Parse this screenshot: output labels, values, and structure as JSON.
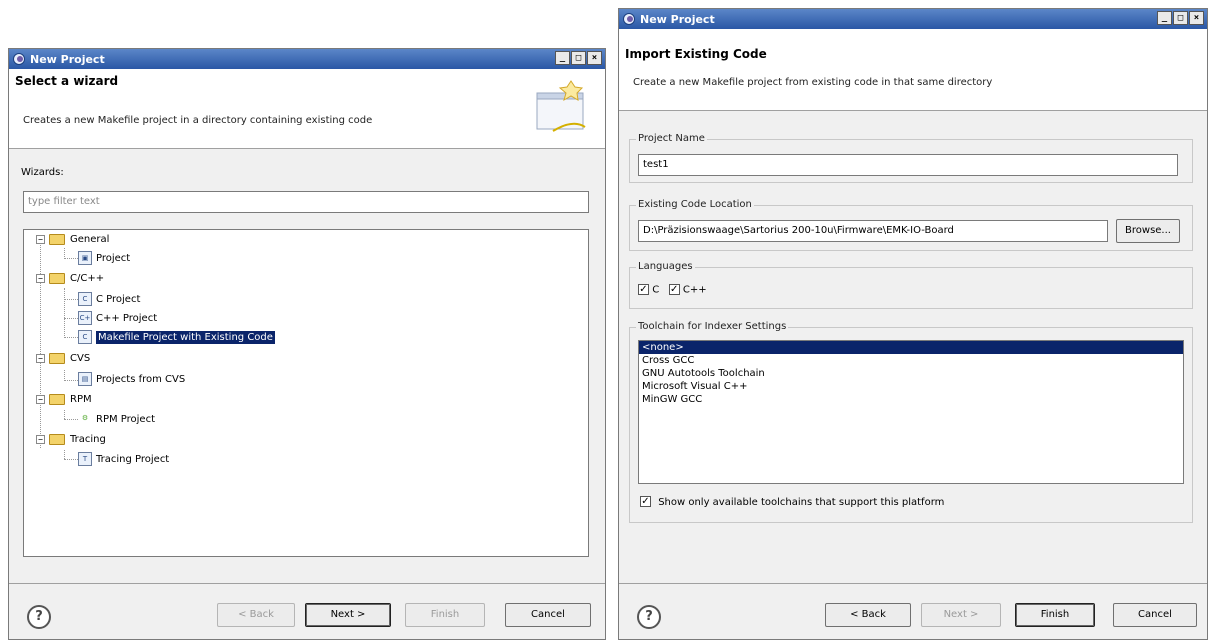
{
  "left_window": {
    "title": "New Project",
    "header_title": "Select a wizard",
    "header_desc": "Creates a new Makefile project in a directory containing existing code",
    "wizards_label": "Wizards:",
    "filter_placeholder": "type filter text",
    "tree": [
      {
        "label": "General",
        "type": "folder",
        "level": 0
      },
      {
        "label": "Project",
        "type": "item",
        "level": 1
      },
      {
        "label": "C/C++",
        "type": "folder",
        "level": 0
      },
      {
        "label": "C Project",
        "type": "item",
        "level": 1,
        "icon_text": "C"
      },
      {
        "label": "C++ Project",
        "type": "item",
        "level": 1,
        "icon_text": "C+"
      },
      {
        "label": "Makefile Project with Existing Code",
        "type": "item",
        "level": 1,
        "selected": true,
        "icon_text": "C"
      },
      {
        "label": "CVS",
        "type": "folder",
        "level": 0
      },
      {
        "label": "Projects from CVS",
        "type": "item",
        "level": 1
      },
      {
        "label": "RPM",
        "type": "folder",
        "level": 0
      },
      {
        "label": "RPM Project",
        "type": "item",
        "level": 1
      },
      {
        "label": "Tracing",
        "type": "folder",
        "level": 0
      },
      {
        "label": "Tracing Project",
        "type": "item",
        "level": 1,
        "icon_text": "T"
      }
    ],
    "buttons": {
      "back": "< Back",
      "next": "Next >",
      "finish": "Finish",
      "cancel": "Cancel"
    }
  },
  "right_window": {
    "title": "New Project",
    "header_title": "Import Existing Code",
    "header_desc": "Create a new Makefile project from existing code in that same directory",
    "project_name_label": "Project Name",
    "project_name_value": "test1",
    "location_label": "Existing Code Location",
    "location_value": "D:\\Präzisionswaage\\Sartorius 200-10u\\Firmware\\EMK-IO-Board",
    "browse_label": "Browse...",
    "languages_label": "Languages",
    "lang_c": "C",
    "lang_cpp": "C++",
    "toolchain_label": "Toolchain for Indexer Settings",
    "toolchains": [
      "<none>",
      "Cross GCC",
      "GNU Autotools Toolchain",
      "Microsoft Visual C++",
      "MinGW GCC"
    ],
    "selected_toolchain": "<none>",
    "show_only_label": "Show only available toolchains that support this platform",
    "buttons": {
      "back": "< Back",
      "next": "Next >",
      "finish": "Finish",
      "cancel": "Cancel"
    }
  },
  "colors": {
    "titlebar": "#2a57a5",
    "selection": "#0a246a",
    "dialog_bg": "#f0f0f0"
  }
}
